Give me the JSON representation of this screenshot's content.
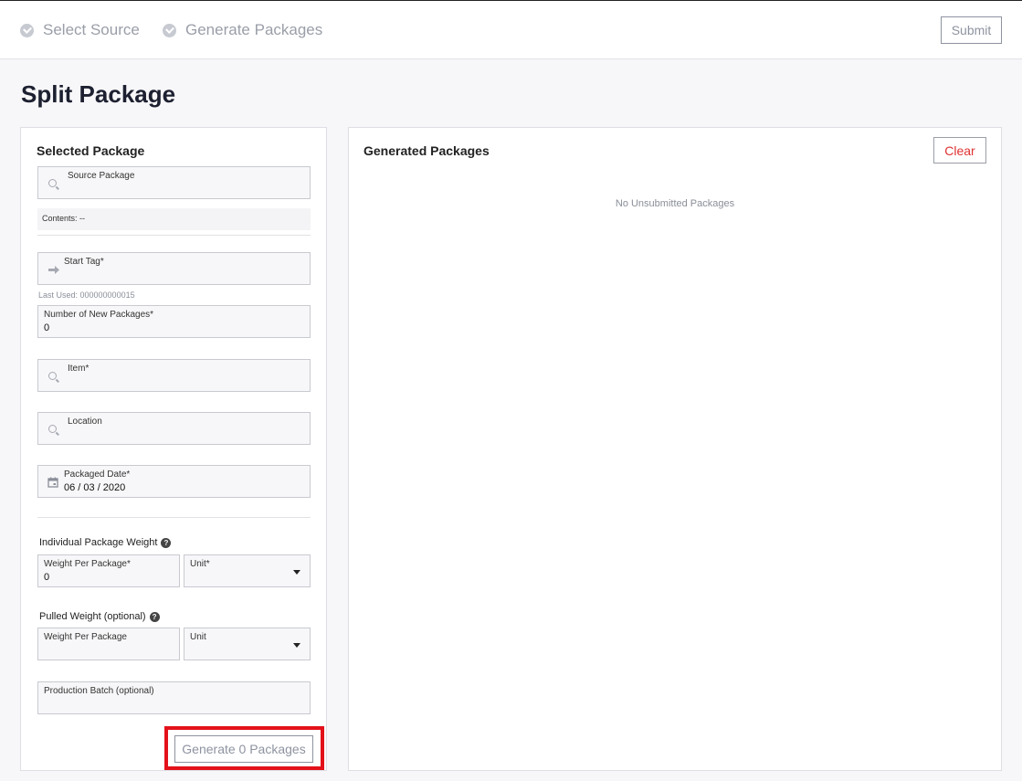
{
  "header": {
    "steps": [
      "Select Source",
      "Generate Packages"
    ],
    "submit_label": "Submit"
  },
  "page_title": "Split Package",
  "selected": {
    "heading": "Selected Package",
    "source_label": "Source Package",
    "contents": "Contents: --",
    "start_tag_label": "Start Tag*",
    "last_used": "Last Used: 000000000015",
    "num_label": "Number of New Packages*",
    "num_value": "0",
    "item_label": "Item*",
    "location_label": "Location",
    "date_label": "Packaged Date*",
    "date_value": "06 / 03 / 2020",
    "ind_weight_label": "Individual Package Weight",
    "weight_label": "Weight Per Package*",
    "weight_value": "0",
    "unit_label": "Unit*",
    "pulled_label": "Pulled Weight (optional)",
    "pulled_weight_label": "Weight Per Package",
    "pulled_unit_label": "Unit",
    "batch_label": "Production Batch (optional)",
    "help_glyph": "?",
    "generate_label": "Generate 0 Packages"
  },
  "generated": {
    "heading": "Generated Packages",
    "clear_label": "Clear",
    "empty": "No Unsubmitted Packages"
  },
  "icons": {
    "step": "check-circle-icon",
    "search": "search-icon",
    "tag": "arrow-right-icon",
    "date": "calendar-icon",
    "help": "help-icon",
    "dropdown": "caret-down-icon"
  },
  "colors": {
    "highlight": "#e3111a",
    "clear": "#e03131",
    "muted": "#8e93a0"
  }
}
